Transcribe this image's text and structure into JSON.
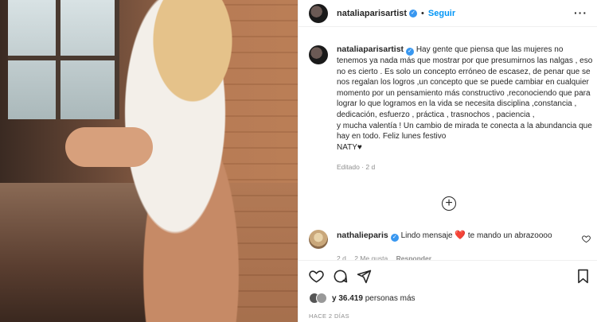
{
  "post": {
    "username": "nataliaparisartist",
    "follow_label": "Seguir",
    "separator": "•",
    "more_label": "···"
  },
  "caption": {
    "username": "nataliaparisartist",
    "text": "Hay gente que piensa que las mujeres no tenemos ya nada más que mostrar por que presumirnos las nalgas , eso no es cierto . Es solo un concepto erróneo de escasez, de penar que se nos regalan los logros ,un concepto que se puede cambiar en cualquier momento por un pensamiento más constructivo ,reconociendo que para lograr lo que logramos en la vida se necesita disciplina ,constancia , dedicación, esfuerzo , práctica , trasnochos , paciencia ,\ny mucha valentía ! Un cambio de mirada te conecta a la abundancia que hay en todo. Feliz lunes festivo\nNATY♥",
    "meta": "Editado · 2 d"
  },
  "load_more_label": "+",
  "comment": {
    "username": "nathalieparis",
    "text": "Lindo mensaje",
    "heart": "❤️",
    "text2": "te mando un abrazoooo",
    "time": "2 d",
    "likes": "2 Me gusta",
    "reply_label": "Responder"
  },
  "likes": {
    "prefix": "y 36.419",
    "suffix": "personas más"
  },
  "date": "HACE 2 DÍAS",
  "icons": {
    "like": "heart-outline-icon",
    "comment": "comment-bubble-icon",
    "share": "paper-plane-icon",
    "save": "bookmark-icon",
    "verified": "verified-badge-icon"
  },
  "colors": {
    "accent": "#0095f6",
    "verified": "#3897f0",
    "muted": "#8e8e8e",
    "heart": "#ed4956"
  }
}
